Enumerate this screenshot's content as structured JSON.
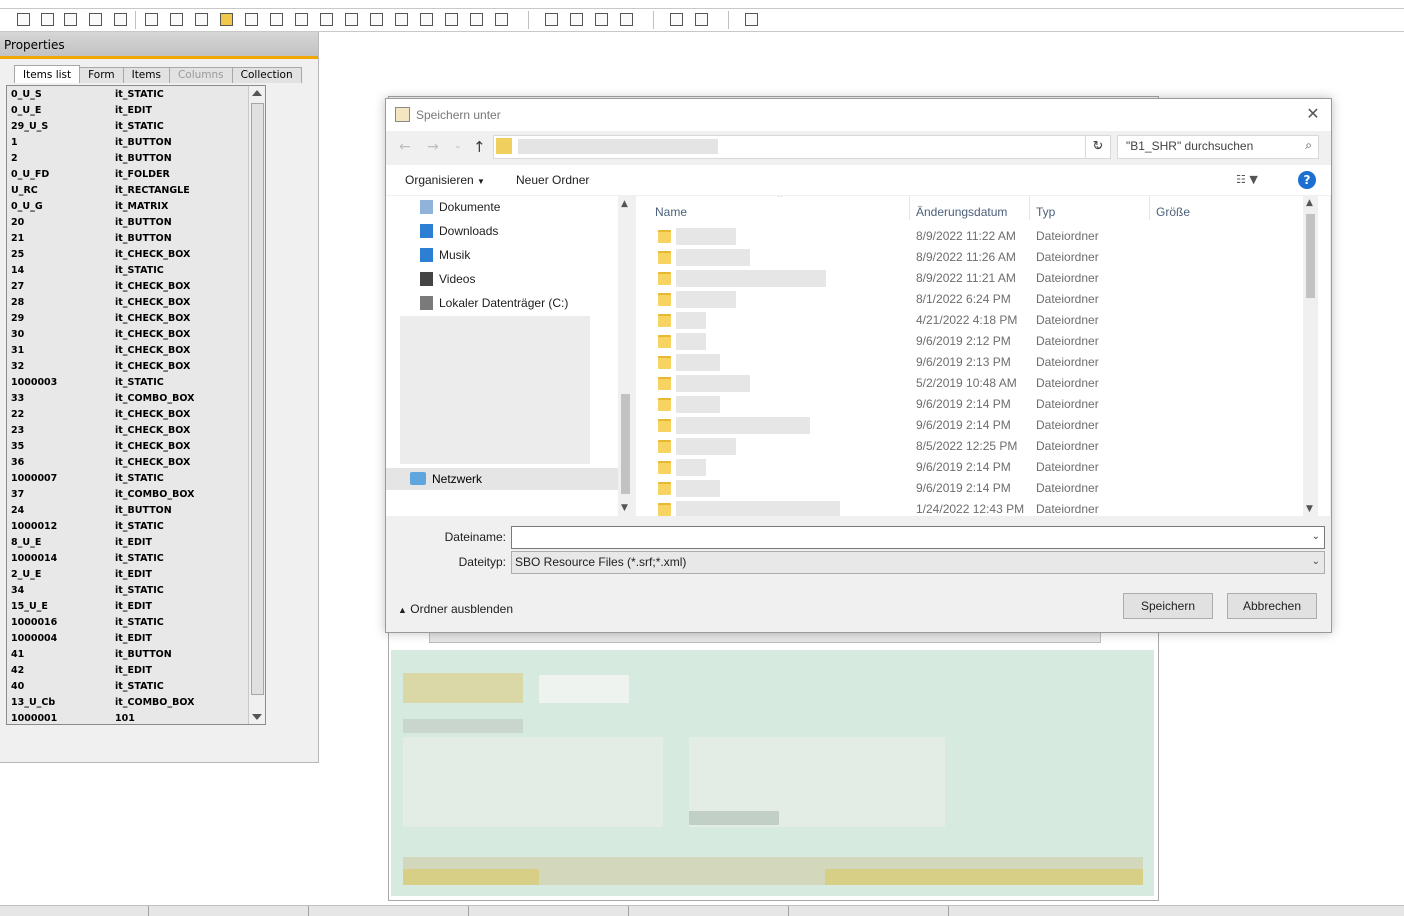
{
  "properties": {
    "title": "Properties",
    "tabs": [
      "Items list",
      "Form",
      "Items",
      "Columns",
      "Collection"
    ],
    "items": [
      [
        "0_U_S",
        "it_STATIC"
      ],
      [
        "0_U_E",
        "it_EDIT"
      ],
      [
        "29_U_S",
        "it_STATIC"
      ],
      [
        "1",
        "it_BUTTON"
      ],
      [
        "2",
        "it_BUTTON"
      ],
      [
        "0_U_FD",
        "it_FOLDER"
      ],
      [
        "U_RC",
        "it_RECTANGLE"
      ],
      [
        "0_U_G",
        "it_MATRIX"
      ],
      [
        "20",
        "it_BUTTON"
      ],
      [
        "21",
        "it_BUTTON"
      ],
      [
        "25",
        "it_CHECK_BOX"
      ],
      [
        "14",
        "it_STATIC"
      ],
      [
        "27",
        "it_CHECK_BOX"
      ],
      [
        "28",
        "it_CHECK_BOX"
      ],
      [
        "29",
        "it_CHECK_BOX"
      ],
      [
        "30",
        "it_CHECK_BOX"
      ],
      [
        "31",
        "it_CHECK_BOX"
      ],
      [
        "32",
        "it_CHECK_BOX"
      ],
      [
        "1000003",
        "it_STATIC"
      ],
      [
        "33",
        "it_COMBO_BOX"
      ],
      [
        "22",
        "it_CHECK_BOX"
      ],
      [
        "23",
        "it_CHECK_BOX"
      ],
      [
        "35",
        "it_CHECK_BOX"
      ],
      [
        "36",
        "it_CHECK_BOX"
      ],
      [
        "1000007",
        "it_STATIC"
      ],
      [
        "37",
        "it_COMBO_BOX"
      ],
      [
        "24",
        "it_BUTTON"
      ],
      [
        "1000012",
        "it_STATIC"
      ],
      [
        "8_U_E",
        "it_EDIT"
      ],
      [
        "1000014",
        "it_STATIC"
      ],
      [
        "2_U_E",
        "it_EDIT"
      ],
      [
        "34",
        "it_STATIC"
      ],
      [
        "15_U_E",
        "it_EDIT"
      ],
      [
        "1000016",
        "it_STATIC"
      ],
      [
        "1000004",
        "it_EDIT"
      ],
      [
        "41",
        "it_BUTTON"
      ],
      [
        "42",
        "it_EDIT"
      ],
      [
        "40",
        "it_STATIC"
      ],
      [
        "13_U_Cb",
        "it_COMBO_BOX"
      ],
      [
        "1000001",
        "101"
      ]
    ]
  },
  "dialog": {
    "title": "Speichern unter",
    "close_glyph": "✕",
    "search_placeholder": "\"B1_SHR\" durchsuchen",
    "organize_label": "Organisieren",
    "new_folder_label": "Neuer Ordner",
    "help_glyph": "?",
    "nav_items": [
      "Dokumente",
      "Downloads",
      "Musik",
      "Videos",
      "Lokaler Datenträger (C:)"
    ],
    "network_label": "Netzwerk",
    "columns": [
      "Name",
      "Änderungsdatum",
      "Typ",
      "Größe"
    ],
    "rows": [
      {
        "date": "8/9/2022 11:22 AM",
        "type": "Dateiordner"
      },
      {
        "date": "8/9/2022 11:26 AM",
        "type": "Dateiordner"
      },
      {
        "date": "8/9/2022 11:21 AM",
        "type": "Dateiordner"
      },
      {
        "date": "8/1/2022 6:24 PM",
        "type": "Dateiordner"
      },
      {
        "date": "4/21/2022 4:18 PM",
        "type": "Dateiordner"
      },
      {
        "date": "9/6/2019 2:12 PM",
        "type": "Dateiordner"
      },
      {
        "date": "9/6/2019 2:13 PM",
        "type": "Dateiordner"
      },
      {
        "date": "5/2/2019 10:48 AM",
        "type": "Dateiordner"
      },
      {
        "date": "9/6/2019 2:14 PM",
        "type": "Dateiordner"
      },
      {
        "date": "9/6/2019 2:14 PM",
        "type": "Dateiordner"
      },
      {
        "date": "8/5/2022 12:25 PM",
        "type": "Dateiordner"
      },
      {
        "date": "9/6/2019 2:14 PM",
        "type": "Dateiordner"
      },
      {
        "date": "9/6/2019 2:14 PM",
        "type": "Dateiordner"
      },
      {
        "date": "1/24/2022 12:43 PM",
        "type": "Dateiordner"
      }
    ],
    "filename_label": "Dateiname:",
    "filename_value": "",
    "filetype_label": "Dateityp:",
    "filetype_value": "SBO Resource Files (*.srf;*.xml)",
    "hide_folders_label": "Ordner ausblenden",
    "save_label": "Speichern",
    "cancel_label": "Abbrechen"
  }
}
